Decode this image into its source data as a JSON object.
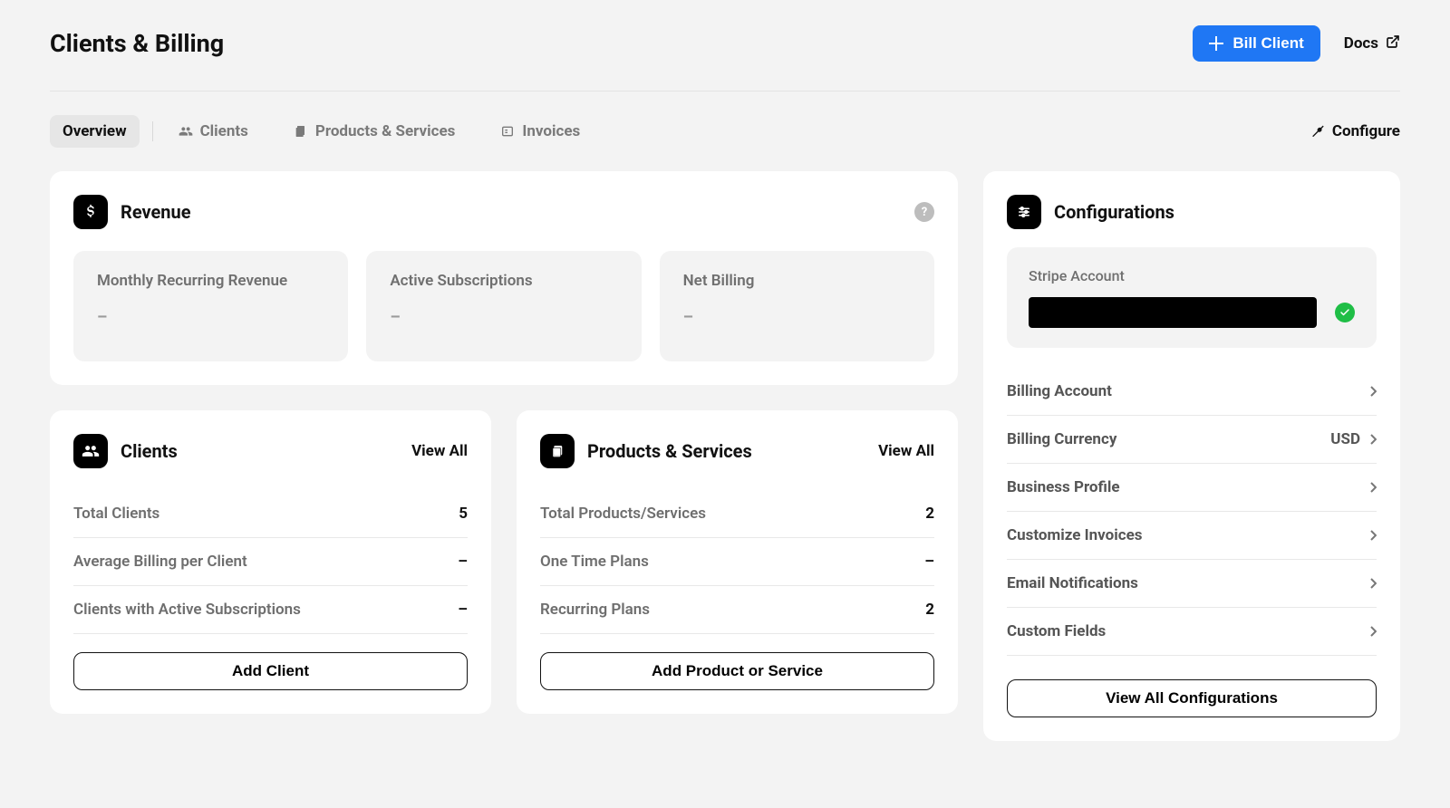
{
  "header": {
    "title": "Clients & Billing",
    "bill_button": "Bill Client",
    "docs_link": "Docs"
  },
  "tabs": {
    "overview": "Overview",
    "clients": "Clients",
    "products": "Products & Services",
    "invoices": "Invoices",
    "configure": "Configure"
  },
  "revenue": {
    "title": "Revenue",
    "stats": [
      {
        "label": "Monthly Recurring Revenue",
        "value": "–"
      },
      {
        "label": "Active Subscriptions",
        "value": "–"
      },
      {
        "label": "Net Billing",
        "value": "–"
      }
    ]
  },
  "clients_card": {
    "title": "Clients",
    "view_all": "View All",
    "rows": [
      {
        "label": "Total Clients",
        "value": "5"
      },
      {
        "label": "Average Billing per Client",
        "value": "–"
      },
      {
        "label": "Clients with Active Subscriptions",
        "value": "–"
      }
    ],
    "button": "Add Client"
  },
  "products_card": {
    "title": "Products & Services",
    "view_all": "View All",
    "rows": [
      {
        "label": "Total Products/Services",
        "value": "2"
      },
      {
        "label": "One Time Plans",
        "value": "–"
      },
      {
        "label": "Recurring Plans",
        "value": "2"
      }
    ],
    "button": "Add Product or Service"
  },
  "configurations": {
    "title": "Configurations",
    "stripe_label": "Stripe Account",
    "items": [
      {
        "label": "Billing Account",
        "value": ""
      },
      {
        "label": "Billing Currency",
        "value": "USD"
      },
      {
        "label": "Business Profile",
        "value": ""
      },
      {
        "label": "Customize Invoices",
        "value": ""
      },
      {
        "label": "Email Notifications",
        "value": ""
      },
      {
        "label": "Custom Fields",
        "value": ""
      }
    ],
    "button": "View All Configurations"
  }
}
